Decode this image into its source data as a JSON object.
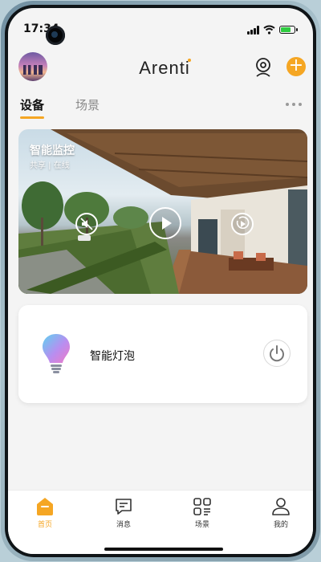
{
  "status_bar": {
    "time": "17:34"
  },
  "header": {
    "brand": "Arenti"
  },
  "tabs": [
    {
      "label": "设备",
      "active": true
    },
    {
      "label": "场景",
      "active": false
    }
  ],
  "camera_card": {
    "title": "智能监控",
    "subtitle": "共享 | 在线",
    "controls": [
      "mute-icon",
      "play-icon",
      "replay-icon"
    ]
  },
  "bulb_card": {
    "name": "智能灯泡",
    "icon": "bulb-icon",
    "power_icon": "power-icon"
  },
  "bottom_nav": [
    {
      "label": "首页",
      "icon": "home-icon",
      "active": true
    },
    {
      "label": "消息",
      "icon": "message-icon",
      "active": false
    },
    {
      "label": "场景",
      "icon": "scene-icon",
      "active": false
    },
    {
      "label": "我的",
      "icon": "profile-icon",
      "active": false
    }
  ],
  "colors": {
    "accent": "#f5a623",
    "background": "#f4f4f4",
    "card": "#ffffff"
  }
}
